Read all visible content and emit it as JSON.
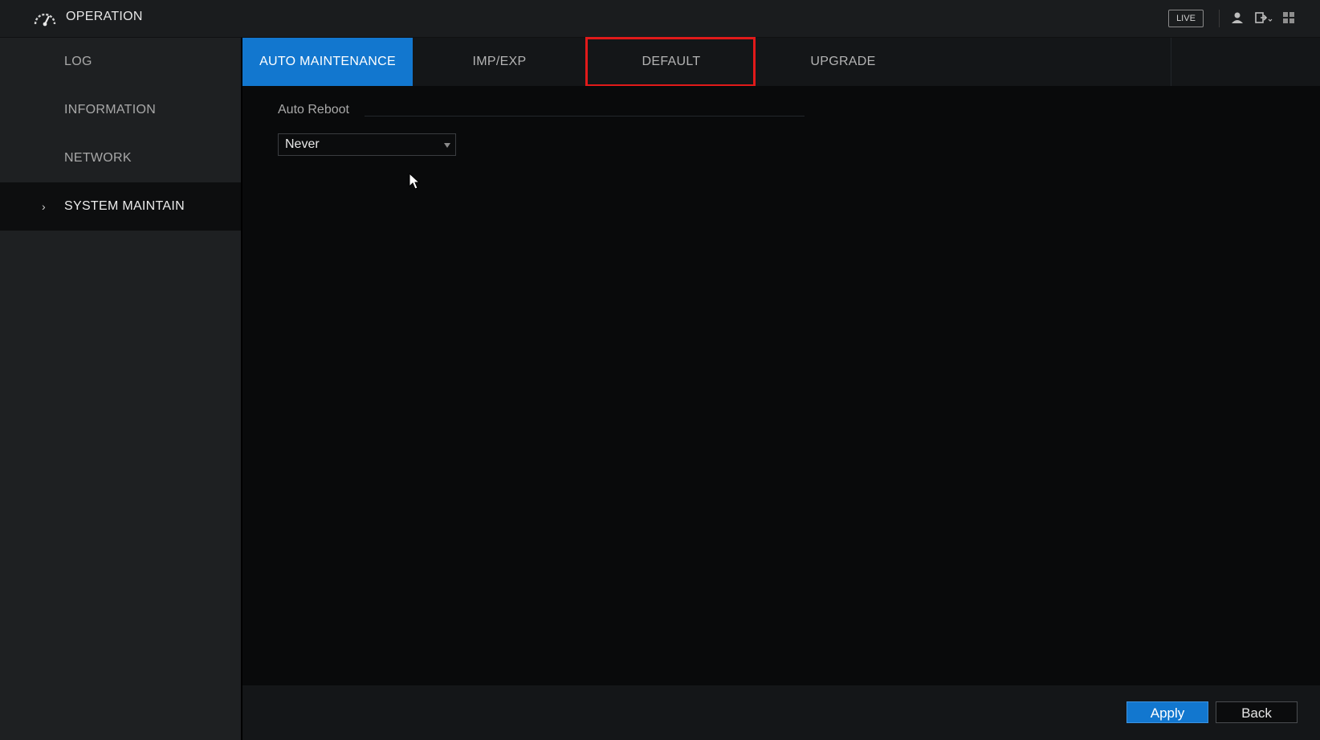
{
  "header": {
    "title": "OPERATION",
    "live_label": "LIVE",
    "icons": [
      "speedometer-icon",
      "user-icon",
      "logout-icon",
      "grid-icon"
    ]
  },
  "sidebar": {
    "items": [
      {
        "label": "LOG",
        "active": false
      },
      {
        "label": "INFORMATION",
        "active": false
      },
      {
        "label": "NETWORK",
        "active": false
      },
      {
        "label": "SYSTEM MAINTAIN",
        "active": true
      }
    ],
    "active_chevron": "›"
  },
  "tabs": [
    {
      "label": "AUTO MAINTENANCE",
      "active": true
    },
    {
      "label": "IMP/EXP",
      "active": false
    },
    {
      "label": "DEFAULT",
      "active": false,
      "highlighted": true
    },
    {
      "label": "UPGRADE",
      "active": false
    }
  ],
  "auto_reboot": {
    "label": "Auto Reboot",
    "selected": "Never"
  },
  "footer": {
    "apply_label": "Apply",
    "back_label": "Back"
  },
  "colors": {
    "accent": "#1277cf",
    "highlight": "#e11a1a",
    "background": "#090a0b"
  }
}
